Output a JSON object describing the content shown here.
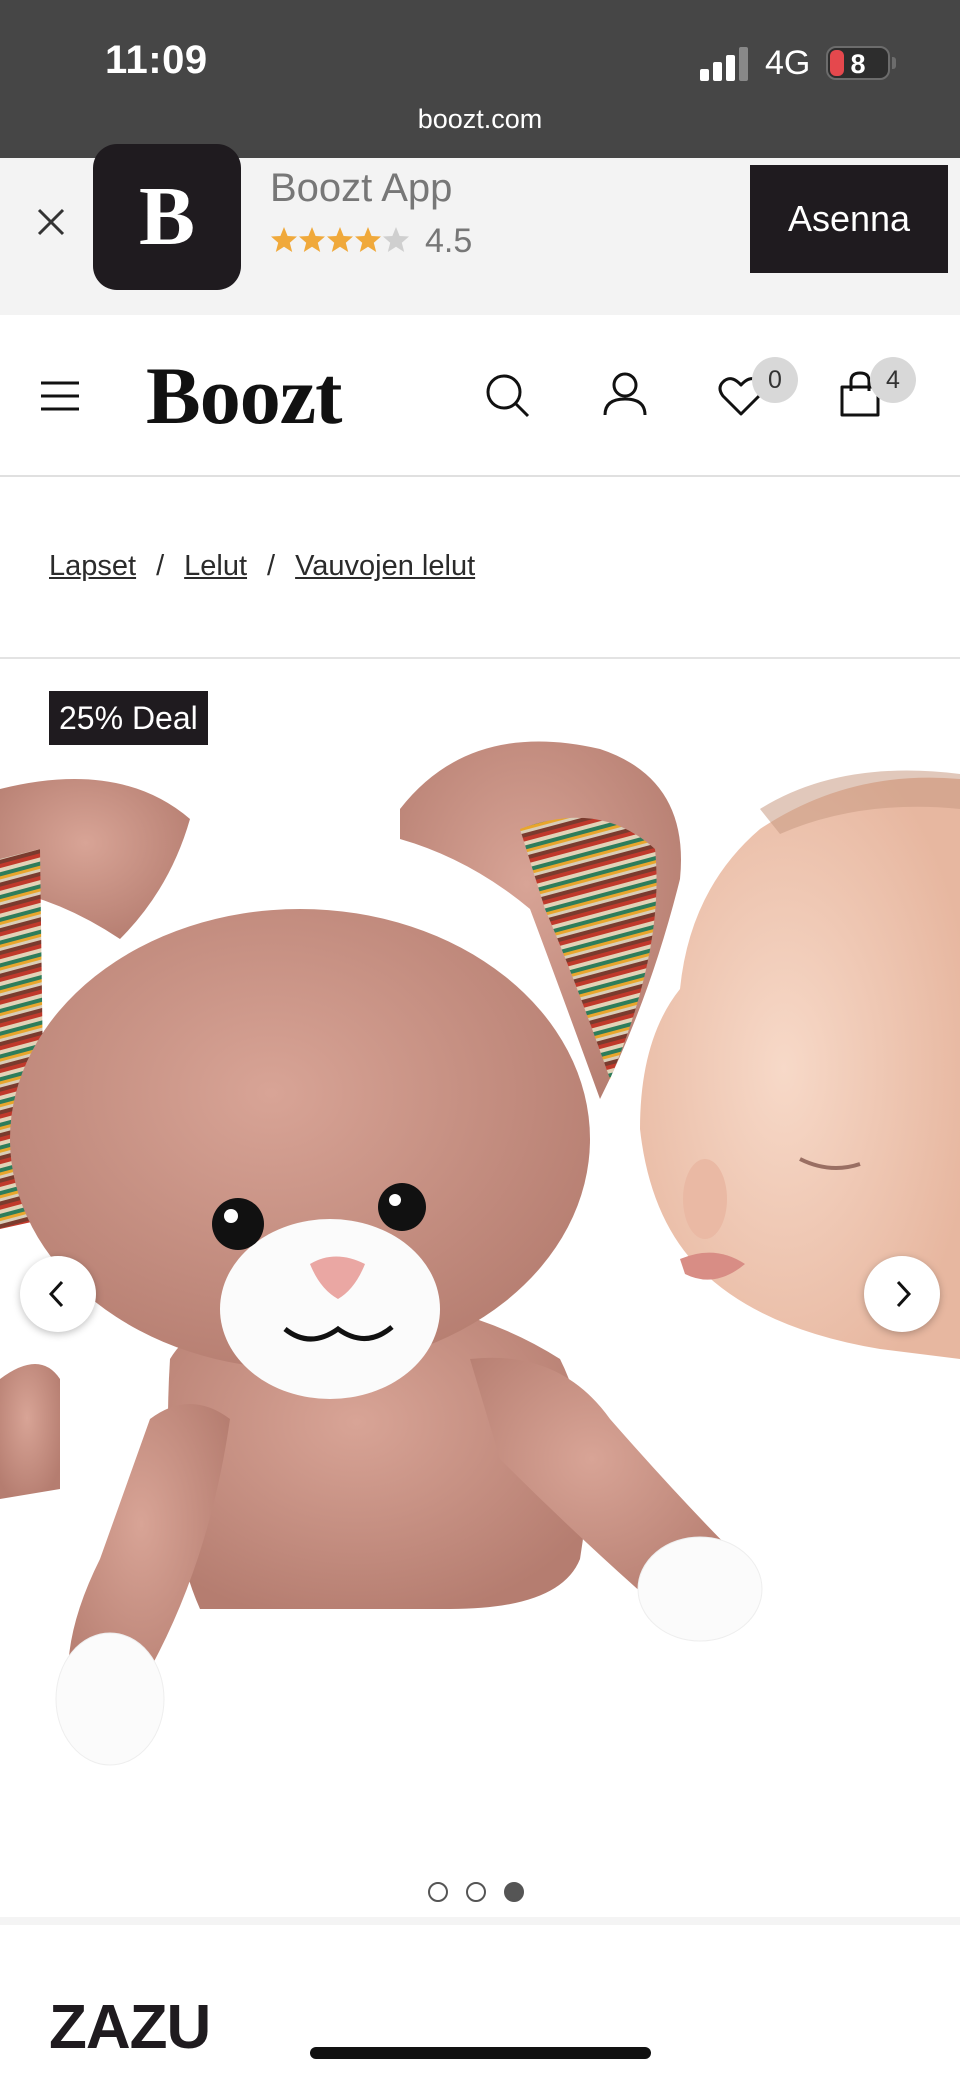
{
  "status_bar": {
    "time": "11:09",
    "network": "4G",
    "battery": "8",
    "url": "boozt.com"
  },
  "app_banner": {
    "app_name": "Boozt App",
    "icon_letter": "B",
    "rating": "4.5",
    "install_label": "Asenna"
  },
  "header": {
    "logo": "Boozt",
    "wishlist_count": "0",
    "cart_count": "4"
  },
  "breadcrumb": {
    "items": [
      "Lapset",
      "Lelut",
      "Vauvojen lelut"
    ],
    "separator": "/"
  },
  "product": {
    "deal_badge": "25% Deal",
    "brand": "ZAZU",
    "image_count": 3,
    "active_image": 3
  },
  "colors": {
    "dark": "#1f1b1f",
    "status_bar": "#464646",
    "banner_bg": "#f3f3f3",
    "star": "#f0a93b",
    "plush": "#c98f82"
  }
}
